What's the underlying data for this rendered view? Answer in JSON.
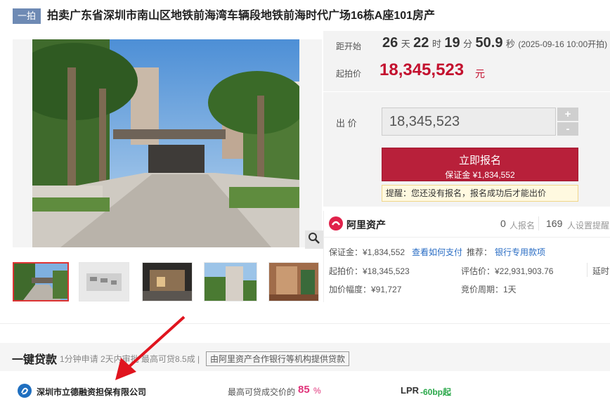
{
  "header": {
    "tag": "一拍",
    "title": "拍卖广东省深圳市南山区地铁前海湾车辆段地铁前海时代广场16栋A座101房产"
  },
  "countdown": {
    "label": "距开始",
    "days": "26",
    "days_unit": "天",
    "hours": "22",
    "hours_unit": "时",
    "minutes": "19",
    "minutes_unit": "分",
    "seconds": "50.9",
    "seconds_unit": "秒",
    "start_note": "(2025-09-16 10:00开拍)"
  },
  "start_price": {
    "label": "起拍价",
    "value": "18,345,523",
    "unit": "元"
  },
  "bid": {
    "label": "出 价",
    "value": "18,345,523",
    "plus": "+",
    "minus": "-",
    "signup_label": "立即报名",
    "deposit_label": "保证金 ¥1,834,552",
    "notice": "提醒：您还没有报名，报名成功后才能出价"
  },
  "platform": {
    "name": "阿里资产",
    "signup_count": "0",
    "signup_unit": "人报名",
    "reminder_count": "169",
    "reminder_unit": "人设置提醒"
  },
  "details": {
    "deposit": "保证金：¥1,834,552",
    "how_to_pay": "查看如何支付",
    "recommend": "推荐：",
    "bank_payment": "银行专用款项",
    "start_price": "起拍价：¥18,345,523",
    "appraisal": "评估价：¥22,931,903.76",
    "delay": "延时",
    "increment": "加价幅度：¥91,727",
    "cycle": "竞价周期：1天"
  },
  "loan": {
    "title": "一键贷款",
    "subtitle": "1分钟申请  2天内审批  最高可贷8.5成 |",
    "partner_note": "由阿里资产合作银行等机构提供贷款",
    "company": "深圳市立德融资担保有限公司",
    "max_ratio_label": "最高可贷成交价的",
    "max_ratio_value": "85",
    "max_ratio_unit": "%",
    "lpr_label": "LPR",
    "lpr_value": "-60bp起"
  },
  "colors": {
    "accent_red": "#b8203a",
    "price_red": "#c3102e",
    "link_blue": "#2a6dc4",
    "tag_blue": "#6e8ab4",
    "pink": "#e0337a",
    "green": "#2aa84a"
  },
  "icons": [
    "magnifier-icon",
    "alibaba-asset-logo",
    "lide-logo-icon",
    "arrow-annotation-icon"
  ]
}
